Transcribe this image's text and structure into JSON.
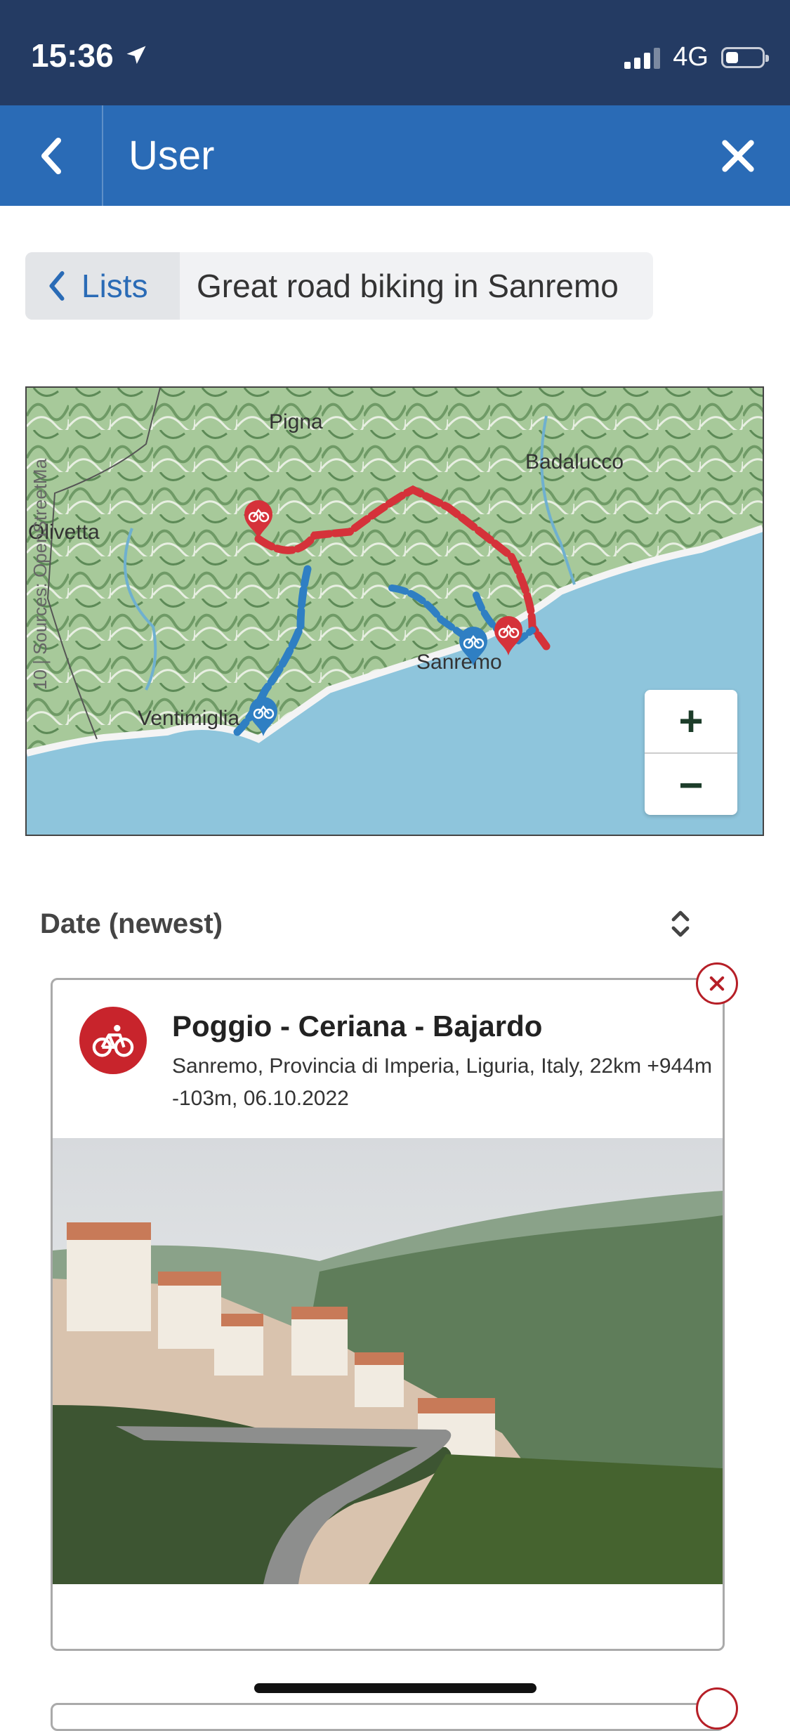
{
  "status": {
    "time": "15:36",
    "network": "4G",
    "battery_level": 0.35
  },
  "appbar": {
    "title": "User"
  },
  "breadcrumb": {
    "parent": "Lists",
    "current": "Great road biking in Sanremo"
  },
  "map": {
    "attribution": "10 | Sources: OpenStreetMa",
    "places": [
      "Pigna",
      "Badalucco",
      "Olivetta",
      "Sanremo",
      "Ventimiglia"
    ],
    "zoom_in": "+",
    "zoom_out": "−",
    "route_colors": {
      "red": "#d5323a",
      "blue": "#2f7fc3"
    }
  },
  "sort": {
    "label": "Date (newest)"
  },
  "tour": {
    "title": "Poggio - Ceriana - Bajardo",
    "meta": "Sanremo, Provincia di Imperia, Liguria, Italy, 22km +944m -103m, 06.10.2022",
    "sport_color": "#c8242c"
  },
  "colors": {
    "statusbar": "#243b63",
    "appbar": "#2a6bb6",
    "accent": "#2a6bb6"
  }
}
